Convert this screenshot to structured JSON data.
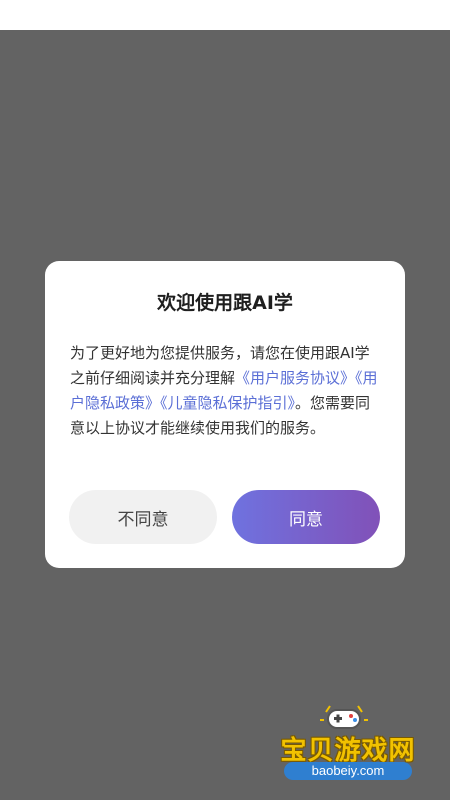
{
  "dialog": {
    "title": "欢迎使用跟AI学",
    "body_intro": "为了更好地为您提供服务，请您在使用跟AI学之前仔细阅读并充分理解",
    "link_user_agreement": "《用户服务协议》",
    "link_privacy_policy": "《用户隐私政策》",
    "link_child_privacy": "《儿童隐私保护指引》",
    "body_outro": "。您需要同意以上协议才能继续使用我们的服务。",
    "disagree_label": "不同意",
    "agree_label": "同意"
  },
  "watermark": {
    "title": "宝贝游戏网",
    "url": "baobeiy.com"
  },
  "colors": {
    "overlay": "#636363",
    "link": "#5b6fd6",
    "agree_gradient_start": "#6f72df",
    "agree_gradient_end": "#8151b8",
    "disagree_bg": "#f1f1f1"
  }
}
